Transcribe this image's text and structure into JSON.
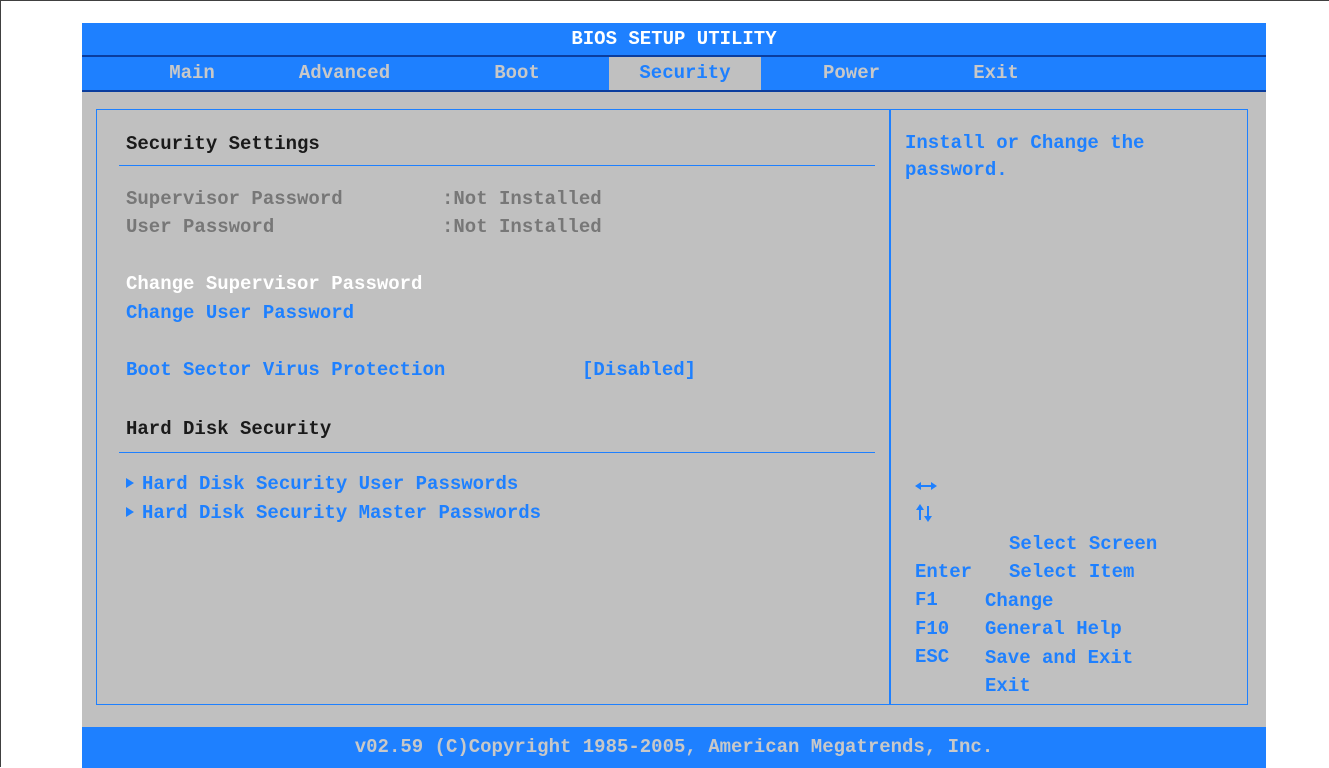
{
  "title": "BIOS SETUP UTILITY",
  "tabs": [
    {
      "label": "Main"
    },
    {
      "label": "Advanced"
    },
    {
      "label": "Boot"
    },
    {
      "label": "Security"
    },
    {
      "label": "Power"
    },
    {
      "label": "Exit"
    }
  ],
  "active_tab": "Security",
  "settings": {
    "heading": "Security Settings",
    "supervisor_password_label": "Supervisor Password",
    "supervisor_password_value": ":Not Installed",
    "user_password_label": "User Password",
    "user_password_value": ":Not Installed",
    "change_supervisor_password": "Change Supervisor Password",
    "change_user_password": "Change User Password",
    "boot_sector_label": "Boot Sector Virus Protection",
    "boot_sector_value": "[Disabled]",
    "hdd_heading": "Hard Disk Security",
    "hdd_user_passwords": "Hard Disk Security User Passwords",
    "hdd_master_passwords": "Hard Disk Security Master Passwords"
  },
  "help": {
    "line1": "Install or Change the",
    "line2": "password."
  },
  "keys": [
    {
      "key": "",
      "icon": "left-right-arrow-icon",
      "desc": "Select Screen"
    },
    {
      "key": "",
      "icon": "up-down-arrow-icon",
      "desc": "Select Item"
    },
    {
      "key": "Enter",
      "desc": "Change"
    },
    {
      "key": "F1",
      "desc": "General Help"
    },
    {
      "key": "F10",
      "desc": "Save and Exit"
    },
    {
      "key": "ESC",
      "desc": "Exit"
    }
  ],
  "footer": "v02.59 (C)Copyright 1985-2005, American Megatrends, Inc.",
  "colors": {
    "accent": "#1e80ff",
    "panel": "#c0c0c0",
    "selected_text": "#ffffff",
    "disabled_text": "#777777"
  }
}
